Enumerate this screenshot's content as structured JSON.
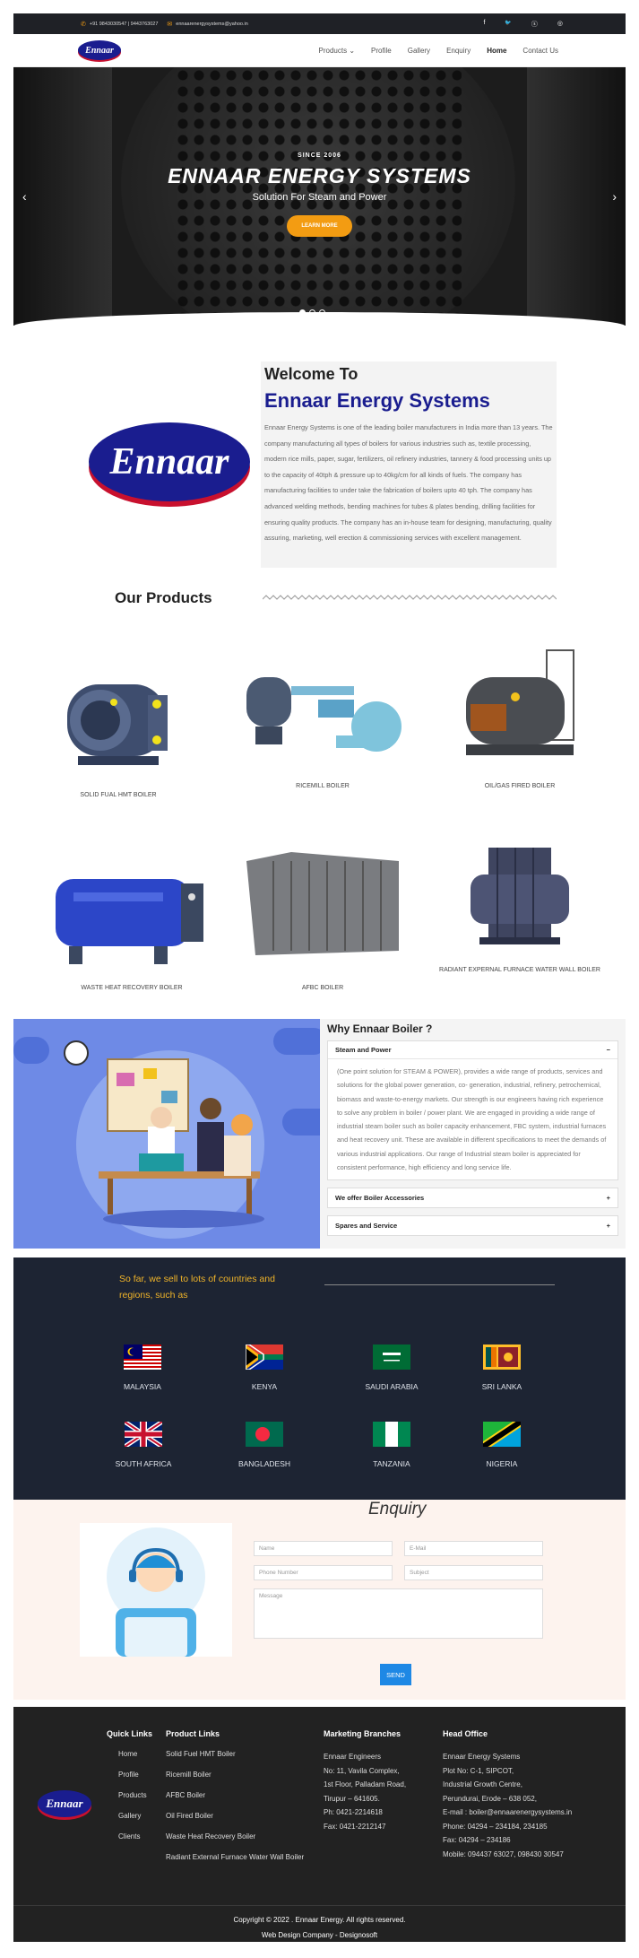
{
  "topbar": {
    "phone": "+91 9843030547 | 9443763027",
    "email": "ennaarenergysystems@yahoo.in",
    "social_icons": [
      "facebook-icon",
      "twitter-icon",
      "skype-icon",
      "instagram-icon"
    ],
    "social_glyphs": [
      "f",
      "🐦",
      "ⓢ",
      "◎"
    ]
  },
  "nav": {
    "logo_text": "Ennaar",
    "items": [
      "Products",
      "Profile",
      "Gallery",
      "Enquiry",
      "Home",
      "Contact Us"
    ],
    "active": "Home"
  },
  "hero": {
    "since": "SINCE 2006",
    "title": "ENNAAR ENERGY SYSTEMS",
    "subtitle": "Solution For Steam and Power",
    "button": "LEARN MORE",
    "prev": "‹",
    "next": "›"
  },
  "welcome": {
    "logo_text": "Ennaar",
    "heading": "Welcome To",
    "company": "Ennaar Energy Systems",
    "paragraph": "Ennaar Energy Systems is one of the leading boiler manufacturers in India more than 13 years. The company manufacturing all types of boilers for various industries such as, textile processing, modern rice mills, paper, sugar, fertilizers, oil refinery industries, tannery & food processing units up to the capacity of 40tph & pressure up to 40kg/cm for all kinds of fuels. The company has manufacturing facilities to under take the fabrication of boilers upto 40 tph. The company has advanced welding methods, bending machines for tubes & plates bending, drilling facilities for ensuring quality products. The company has an in-house team for designing, manufacturing, quality assuring, marketing, well erection & commissioning services with excellent management."
  },
  "products": {
    "heading": "Our Products",
    "items": [
      "SOLID FUAL HMT BOILER",
      "RICEMILL BOILER",
      "OIL/GAS FIRED BOILER",
      "WASTE HEAT RECOVERY BOILER",
      "AFBC BOILER",
      "RADIANT EXPERNAL FURNACE WATER WALL BOILER"
    ]
  },
  "why": {
    "heading": "Why Ennaar Boiler ?",
    "acc1_title": "Steam and Power",
    "acc1_icon": "−",
    "acc1_body": "(One point solution for STEAM & POWER), provides a wide range of products, services and solutions for the global power generation, co- generation, industrial, refinery, petrochemical, biomass and waste-to-energy markets. Our strength is our engineers having rich experience to solve any problem in boiler / power plant. We are engaged in providing a wide range of industrial steam boiler such as boiler capacity enhancement, FBC system, industrial furnaces and heat recovery unit. These are available in different specifications to meet the demands of various industrial applications. Our range of Industrial steam boiler is appreciated for consistent performance, high efficiency and long service life.",
    "acc2_title": "We offer Boiler Accessories",
    "acc3_title": "Spares and Service",
    "plus": "+"
  },
  "countries": {
    "lead": "So far, we sell to lots of countries and regions, such as",
    "names": [
      "MALAYSIA",
      "KENYA",
      "SAUDI ARABIA",
      "SRI LANKA",
      "SOUTH AFRICA",
      "BANGLADESH",
      "TANZANIA",
      "NIGERIA"
    ]
  },
  "enquiry": {
    "heading": "Enquiry",
    "name_ph": "Name",
    "email_ph": "E-Mail",
    "phone_ph": "Phone Number",
    "subject_ph": "Subject",
    "message_ph": "Message",
    "send": "SEND"
  },
  "footer": {
    "logo_text": "Ennaar",
    "quick_title": "Quick Links",
    "quick": [
      "Home",
      "Profile",
      "Products",
      "Gallery",
      "Clients"
    ],
    "product_title": "Product Links",
    "product_links": [
      "Solid Fuel HMT Boiler",
      "Ricemill Boiler",
      "AFBC Boiler",
      "Oil Fired Boiler",
      "Waste Heat Recovery Boiler",
      "Radiant External Furnace Water Wall Boiler"
    ],
    "marketing_title": "Marketing Branches",
    "marketing": [
      "Ennaar Engineers",
      "No: 11, Vavila Complex,",
      "1st Floor, Palladam Road,",
      "Tirupur – 641605.",
      "Ph: 0421-2214618",
      "Fax: 0421-2212147"
    ],
    "office_title": "Head Office",
    "office": [
      "Ennaar Energy Systems",
      "Plot No: C-1, SIPCOT,",
      "Industrial Growth Centre,",
      "Perundurai, Erode – 638 052,",
      "E-mail : boiler@ennaarenergysystems.in",
      "Phone: 04294 – 234184, 234185",
      "Fax: 04294 – 234186",
      "Mobile: 094437 63027, 098430 30547"
    ],
    "copyright": "Copyright © 2022 . Ennaar Energy. All rights reserved.",
    "credit": "Web Design Company -   Designosoft"
  }
}
